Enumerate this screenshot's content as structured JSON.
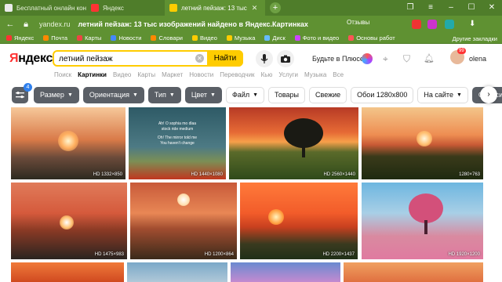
{
  "browser": {
    "tabs": [
      {
        "label": "Бесплатный онлайн конс"
      },
      {
        "label": "Яндекс"
      },
      {
        "label": "летний пейзаж: 13 тыс",
        "active": true
      }
    ],
    "url_host": "yandex.ru",
    "url_title": "летний пейзаж: 13 тыс изображений найдено в Яндекс.Картинках",
    "reviews": "Отзывы",
    "bookmarks": [
      "Яндекс",
      "Почта",
      "Карты",
      "Новости",
      "Словари",
      "Видео",
      "Музыка",
      "Диск",
      "Фото и видео",
      "Основы работ"
    ],
    "other_bookmarks": "Другие закладки"
  },
  "header": {
    "logo": "Яндекс",
    "search_value": "летний пейзаж",
    "find_label": "Найти",
    "plus_text": "Будьте в Плюсе",
    "user": "olena",
    "notify_count": "99"
  },
  "services": [
    "Поиск",
    "Картинки",
    "Видео",
    "Карты",
    "Маркет",
    "Новости",
    "Переводчик",
    "Кью",
    "Услуги",
    "Музыка",
    "Все"
  ],
  "filters": {
    "settings_badge": "4",
    "items": [
      {
        "label": "Размер",
        "chev": true,
        "dark": true
      },
      {
        "label": "Ориентация",
        "chev": true,
        "dark": true
      },
      {
        "label": "Тип",
        "chev": true,
        "dark": true
      },
      {
        "label": "Цвет",
        "chev": true,
        "dark": true
      },
      {
        "label": "Файл",
        "chev": true,
        "dark": false
      },
      {
        "label": "Товары",
        "chev": false,
        "dark": false
      },
      {
        "label": "Свежие",
        "chev": false,
        "dark": false
      },
      {
        "label": "Обои 1280x800",
        "chev": false,
        "dark": false
      },
      {
        "label": "На сайте",
        "chev": true,
        "dark": false
      },
      {
        "label": "Сбросить",
        "chev": false,
        "dark": true
      }
    ]
  },
  "images": [
    {
      "res": "HD 1332×850"
    },
    {
      "res": "HD 1440×1080",
      "poem": [
        "Ah! O sophia mo dlaa",
        "stock ride medium",
        "Oh! The mirror told me",
        "You haven't change"
      ]
    },
    {
      "res": "HD 2560×1440"
    },
    {
      "res": "1280×763"
    },
    {
      "res": "HD 1475×983"
    },
    {
      "res": "HD 1200×864"
    },
    {
      "res": "HD 2200×1437"
    },
    {
      "res": "HD 1920×1200"
    }
  ],
  "colors": {
    "accent_yellow": "#ffcc00",
    "browser_green": "#5f9132"
  }
}
